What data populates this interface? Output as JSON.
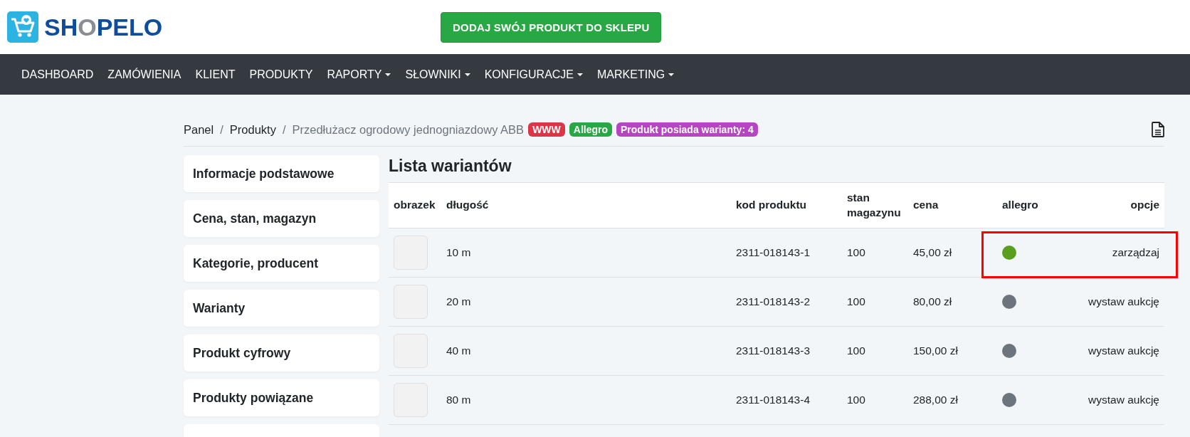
{
  "header": {
    "logo_text_parts": [
      "SH",
      "O",
      "PELO"
    ],
    "cta_button": "DODAJ SWÓJ PRODUKT DO SKLEPU"
  },
  "nav": [
    {
      "label": "DASHBOARD",
      "dropdown": false
    },
    {
      "label": "ZAMÓWIENIA",
      "dropdown": false
    },
    {
      "label": "KLIENT",
      "dropdown": false
    },
    {
      "label": "PRODUKTY",
      "dropdown": false
    },
    {
      "label": "RAPORTY",
      "dropdown": true
    },
    {
      "label": "SŁOWNIKI",
      "dropdown": true
    },
    {
      "label": "KONFIGURACJE",
      "dropdown": true
    },
    {
      "label": "MARKETING",
      "dropdown": true
    }
  ],
  "breadcrumb": {
    "items": [
      {
        "label": "Panel",
        "separator": "/"
      },
      {
        "label": "Produkty",
        "separator": "/"
      }
    ],
    "current": "Przedłużacz ogrodowy jednogniazdowy ABB",
    "badges": [
      {
        "label": "WWW",
        "color": "#dc3545"
      },
      {
        "label": "Allegro",
        "color": "#28a745"
      },
      {
        "label": "Produkt posiada warianty: 4",
        "color": "#b545c0"
      }
    ]
  },
  "sidebar": {
    "items": [
      "Informacje podstawowe",
      "Cena, stan, magazyn",
      "Kategorie, producent",
      "Warianty",
      "Produkt cyfrowy",
      "Produkty powiązane"
    ]
  },
  "variants": {
    "title": "Lista wariantów",
    "columns": [
      "obrazek",
      "długość",
      "kod produktu",
      "stan magazynu",
      "cena",
      "allegro",
      "opcje"
    ],
    "rows": [
      {
        "length": "10 m",
        "code": "2311-018143-1",
        "stock": "100",
        "price": "45,00 zł",
        "color": "#5a9e1f",
        "option": "zarządzaj",
        "highlighted": true
      },
      {
        "length": "20 m",
        "code": "2311-018143-2",
        "stock": "100",
        "price": "80,00 zł",
        "color": "#6c757d",
        "option": "wystaw aukcję",
        "highlighted": false
      },
      {
        "length": "40 m",
        "code": "2311-018143-3",
        "stock": "100",
        "price": "150,00 zł",
        "color": "#6c757d",
        "option": "wystaw aukcję",
        "highlighted": false
      },
      {
        "length": "80 m",
        "code": "2311-018143-4",
        "stock": "100",
        "price": "288,00 zł",
        "color": "#6c757d",
        "option": "wystaw aukcję",
        "highlighted": false
      }
    ]
  }
}
